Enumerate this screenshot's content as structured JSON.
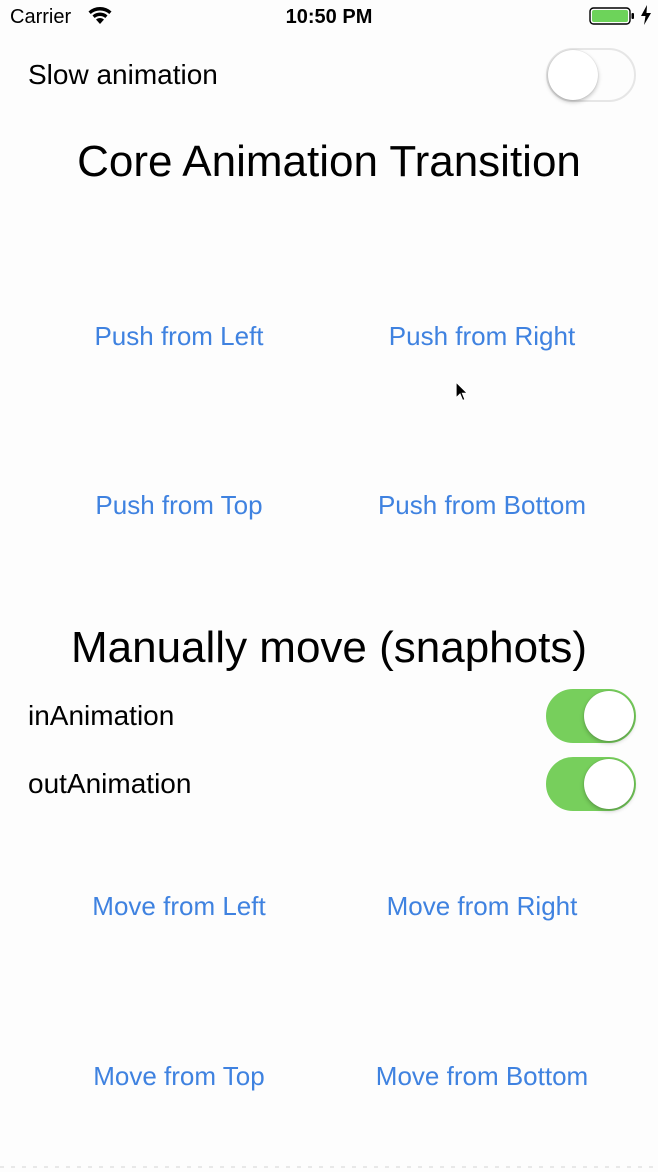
{
  "status_bar": {
    "carrier": "Carrier",
    "time": "10:50 PM",
    "wifi_icon": "wifi-icon",
    "battery_icon": "battery-icon",
    "charging_icon": "charging-bolt-icon",
    "battery_color": "#6dd35a"
  },
  "settings": {
    "slow_animation": {
      "label": "Slow animation",
      "on": false
    }
  },
  "core_animation": {
    "title": "Core Animation Transition",
    "buttons": {
      "push_left": "Push from Left",
      "push_right": "Push from Right",
      "push_top": "Push from Top",
      "push_bottom": "Push from Bottom"
    }
  },
  "manual_move": {
    "title": "Manually move (snaphots)",
    "in_animation": {
      "label": "inAnimation",
      "on": true
    },
    "out_animation": {
      "label": "outAnimation",
      "on": true
    },
    "buttons": {
      "move_left": "Move from Left",
      "move_right": "Move from Right",
      "move_top": "Move from Top",
      "move_bottom": "Move from Bottom"
    }
  },
  "colors": {
    "tint": "#3f82e0",
    "switch_on": "#77cf5c",
    "background": "#fdfdfd"
  }
}
